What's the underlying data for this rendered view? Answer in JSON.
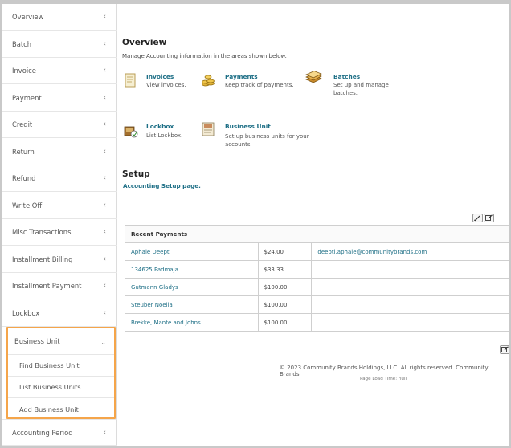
{
  "sidebar": {
    "items": [
      {
        "label": "Overview"
      },
      {
        "label": "Batch"
      },
      {
        "label": "Invoice"
      },
      {
        "label": "Payment"
      },
      {
        "label": "Credit"
      },
      {
        "label": "Return"
      },
      {
        "label": "Refund"
      },
      {
        "label": "Write Off"
      },
      {
        "label": "Misc Transactions"
      },
      {
        "label": "Installment Billing"
      },
      {
        "label": "Installment Payment"
      },
      {
        "label": "Lockbox"
      }
    ],
    "business_unit": {
      "label": "Business Unit",
      "subitems": [
        {
          "label": "Find Business Unit"
        },
        {
          "label": "List Business Units"
        },
        {
          "label": "Add Business Unit"
        }
      ]
    },
    "accounting_period": {
      "label": "Accounting Period"
    },
    "chevron_left": "‹",
    "chevron_down": "⌄"
  },
  "overview": {
    "title": "Overview",
    "description": "Manage Accounting information in the areas shown below.",
    "cards": [
      {
        "title": "Invoices",
        "desc1": "View invoices.",
        "desc2": "",
        "icon": "invoice-icon"
      },
      {
        "title": "Payments",
        "desc1": "Keep track of payments.",
        "desc2": "",
        "icon": "payments-coins-icon"
      },
      {
        "title": "Batches",
        "desc1": "Set up and manage",
        "desc2": "batches.",
        "icon": "batches-icon"
      },
      {
        "title": "Lockbox",
        "desc1": "List Lockbox.",
        "desc2": "",
        "icon": "lockbox-icon"
      },
      {
        "title": "Business Unit",
        "desc1": "Set up business units for your",
        "desc2": "accounts.",
        "icon": "business-unit-icon"
      }
    ]
  },
  "setup": {
    "title": "Setup",
    "link": "Accounting Setup page."
  },
  "recent_payments": {
    "header": "Recent Payments",
    "rows": [
      {
        "name": "Aphale Deepti",
        "amount": "$24.00",
        "email": "deepti.aphale@communitybrands.com"
      },
      {
        "name": "134625 Padmaja",
        "amount": "$33.33",
        "email": ""
      },
      {
        "name": "Gutmann Gladys",
        "amount": "$100.00",
        "email": ""
      },
      {
        "name": "Steuber Noella",
        "amount": "$100.00",
        "email": ""
      },
      {
        "name": "Brekke, Mante and Johns",
        "amount": "$100.00",
        "email": ""
      }
    ]
  },
  "footer": {
    "copyright": "© 2023 Community Brands Holdings, LLC. All rights reserved. Community Brands",
    "load_time": "Page Load Time: null"
  }
}
